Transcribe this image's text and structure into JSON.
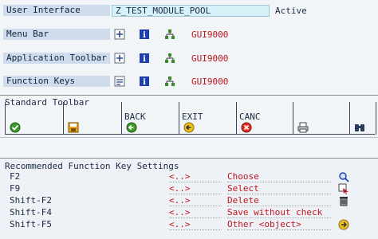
{
  "header": {
    "user_interface_label": "User Interface",
    "program_name": "Z_TEST_MODULE_POOL",
    "status": "Active"
  },
  "rows": [
    {
      "label": "Menu Bar",
      "value": "GUI9000"
    },
    {
      "label": "Application Toolbar",
      "value": "GUI9000"
    },
    {
      "label": "Function Keys",
      "value": "GUI9000"
    }
  ],
  "standard_toolbar": {
    "title": "Standard Toolbar",
    "cells": [
      {
        "name": "",
        "icon": "check-icon"
      },
      {
        "name": "",
        "icon": "save-icon"
      },
      {
        "name": "BACK",
        "icon": "back-icon"
      },
      {
        "name": "EXIT",
        "icon": "exit-icon"
      },
      {
        "name": "CANC",
        "icon": "cancel-icon"
      },
      {
        "name": "",
        "icon": "print-icon"
      },
      {
        "name": "",
        "icon": "find-icon"
      }
    ]
  },
  "recommended": {
    "title": "Recommended Function Key Settings",
    "items": [
      {
        "key": "F2",
        "code": "<..>",
        "text": "Choose",
        "icon": "choose-icon"
      },
      {
        "key": "F9",
        "code": "<..>",
        "text": "Select",
        "icon": "select-icon"
      },
      {
        "key": "Shift-F2",
        "code": "<..>",
        "text": "Delete",
        "icon": "delete-icon"
      },
      {
        "key": "Shift-F4",
        "code": "<..>",
        "text": "Save without check",
        "icon": ""
      },
      {
        "key": "Shift-F5",
        "code": "<..>",
        "text": "Other <object>",
        "icon": "other-object-icon"
      }
    ]
  },
  "colors": {
    "label_bg": "#cfdcec",
    "field_bg": "#d6f2f8",
    "red_text": "#c0141c"
  }
}
